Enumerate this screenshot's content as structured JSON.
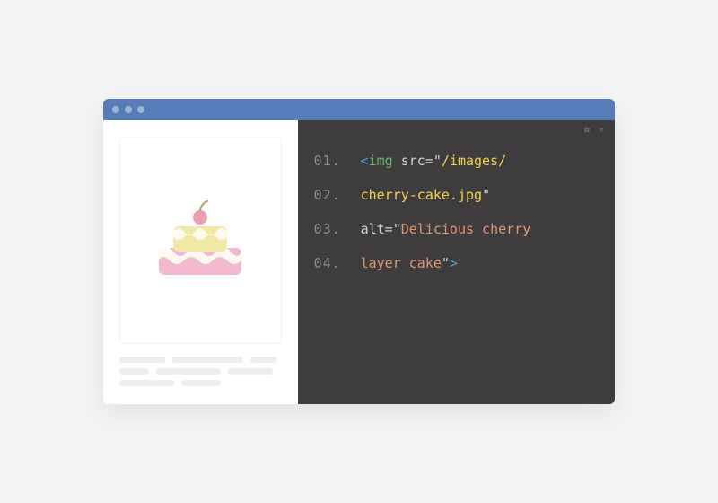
{
  "code": {
    "line_numbers": [
      "01.",
      "02.",
      "03.",
      "04."
    ],
    "tokens": {
      "lt": "<",
      "gt": ">",
      "tag": "img",
      "src_attr": " src=",
      "src_q_open": "\"",
      "src_part1": "/images/",
      "src_part2": "cherry-cake.jpg",
      "src_q_close": "\"",
      "alt_attr": "alt=",
      "alt_q_open": "\"",
      "alt_part1": "Delicious cherry",
      "alt_part2": "layer cake",
      "alt_q_close": "\""
    }
  },
  "colors": {
    "cake_base": "#f3b9cf",
    "cake_icing": "#f2e8a6",
    "cake_cream": "#fffaf0",
    "cherry": "#ec9eb0",
    "cherry_stem": "#b9a06a"
  }
}
